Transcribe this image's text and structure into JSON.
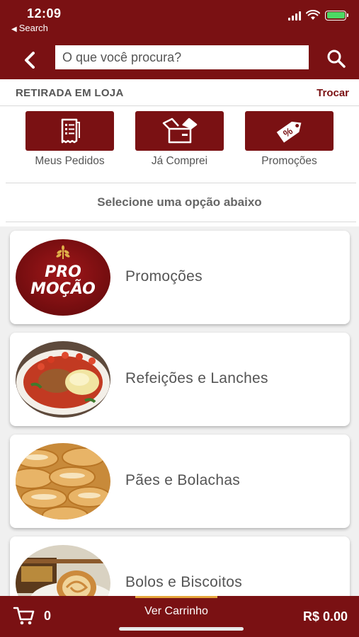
{
  "status_bar": {
    "time": "12:09",
    "back_app": "Search"
  },
  "header": {
    "search_placeholder": "O que você procura?"
  },
  "pickup": {
    "label": "RETIRADA EM LOJA",
    "change_label": "Trocar"
  },
  "quick_actions": [
    {
      "label": "Meus Pedidos",
      "icon": "receipt-icon"
    },
    {
      "label": "Já Comprei",
      "icon": "open-box-icon"
    },
    {
      "label": "Promoções",
      "icon": "price-tag-percent-icon"
    }
  ],
  "section_title": "Selecione uma opção abaixo",
  "categories": [
    {
      "label": "Promoções",
      "badge_lines": [
        "PRO",
        "MOÇÃO"
      ]
    },
    {
      "label": "Refeições e Lanches"
    },
    {
      "label": "Pães e Bolachas"
    },
    {
      "label": "Bolos e Biscoitos"
    }
  ],
  "bottom_bar": {
    "cart_count": "0",
    "view_cart_label": "Ver Carrinho",
    "total": "R$ 0.00"
  },
  "colors": {
    "brand": "#7a1113",
    "accent_underline": "#e6a63c",
    "background_list": "#f0f0f0"
  }
}
